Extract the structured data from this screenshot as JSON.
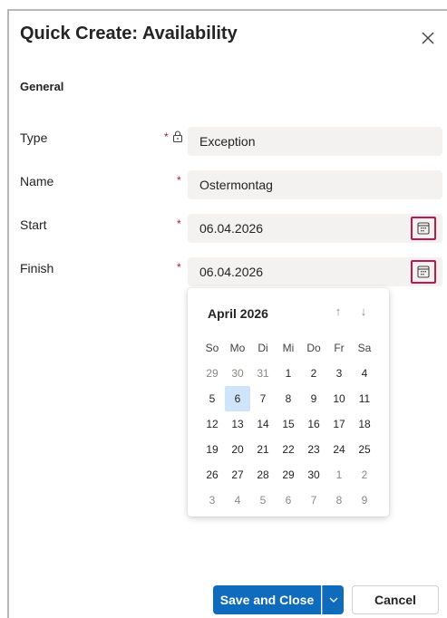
{
  "dialog": {
    "title": "Quick Create: Availability",
    "section_label": "General"
  },
  "form": {
    "type_label": "Type",
    "type_value": "Exception",
    "name_label": "Name",
    "name_value": "Ostermontag",
    "start_label": "Start",
    "start_value": "06.04.2026",
    "finish_label": "Finish",
    "finish_value": "06.04.2026",
    "required_mark": "*"
  },
  "calendar": {
    "month_label": "April 2026",
    "prev_arrow": "↑",
    "next_arrow": "↓",
    "weekdays": [
      "So",
      "Mo",
      "Di",
      "Mi",
      "Do",
      "Fr",
      "Sa"
    ],
    "weeks": [
      [
        "29",
        "30",
        "31",
        "1",
        "2",
        "3",
        "4"
      ],
      [
        "5",
        "6",
        "7",
        "8",
        "9",
        "10",
        "11"
      ],
      [
        "12",
        "13",
        "14",
        "15",
        "16",
        "17",
        "18"
      ],
      [
        "19",
        "20",
        "21",
        "22",
        "23",
        "24",
        "25"
      ],
      [
        "26",
        "27",
        "28",
        "29",
        "30",
        "1",
        "2"
      ],
      [
        "3",
        "4",
        "5",
        "6",
        "7",
        "8",
        "9"
      ]
    ],
    "selected_day": "6"
  },
  "footer": {
    "save_label": "Save and Close",
    "cancel_label": "Cancel"
  },
  "colors": {
    "primary": "#0f6cbd",
    "highlight_border": "#c0174d",
    "selected_day_bg": "#cfe4fa",
    "required": "#a4262c"
  }
}
